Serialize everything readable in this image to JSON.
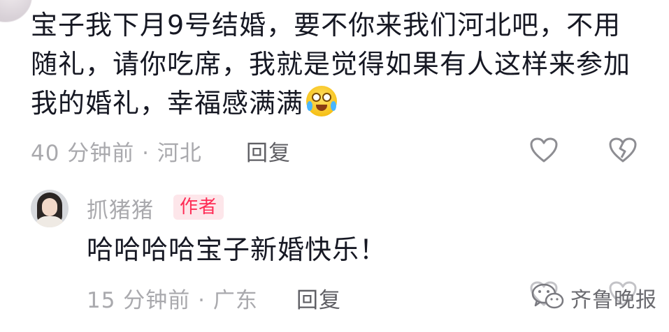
{
  "comment": {
    "text": "宝子我下月9号结婚，要不你来我们河北吧，不用随礼，请你吃席，我就是觉得如果有人这样来参加我的婚礼，幸福感满满",
    "emoji": "crying-laughing-emoji",
    "meta": "40 分钟前 · 河北",
    "reply_label": "回复"
  },
  "reply": {
    "username": "抓猪猪",
    "badge": "作者",
    "text": "哈哈哈哈宝子新婚快乐！",
    "meta": "15 分钟前 · 广东",
    "reply_label": "回复"
  },
  "watermark": {
    "text": "齐鲁晚报",
    "icon": "wechat-icon"
  },
  "icons": {
    "like": "heart-outline-icon",
    "dislike": "broken-heart-icon"
  },
  "colors": {
    "text_primary": "#161823",
    "text_secondary": "#a9a9ad",
    "author_badge": "#fe2c55",
    "author_badge_bg": "#fde6ea"
  }
}
